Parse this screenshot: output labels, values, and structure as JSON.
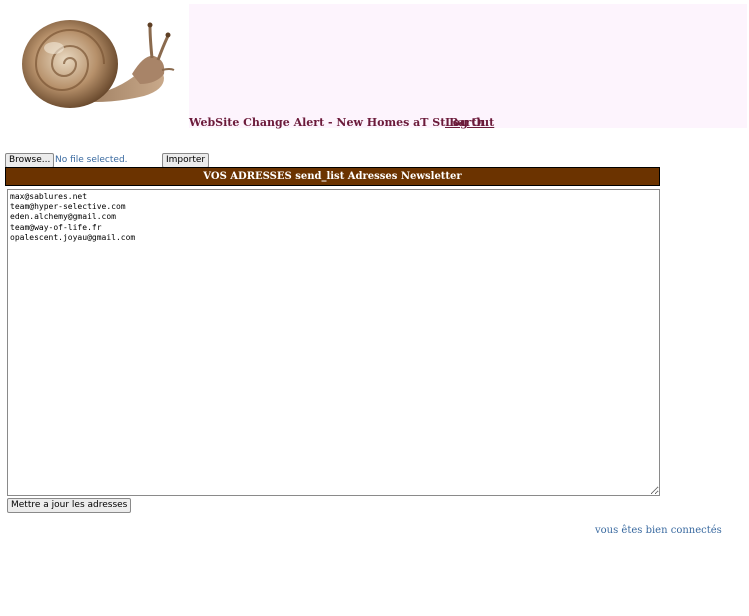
{
  "header": {
    "site_title": "WebSite Change Alert - New Homes aT St Barth",
    "logout_label": "Log Out",
    "logo_icon": "snail-logo"
  },
  "import": {
    "browse_label": "Browse...",
    "file_status": "No file selected.",
    "import_label": "Importer"
  },
  "section": {
    "title": "VOS ADRESSES send_list Adresses Newsletter"
  },
  "addresses": {
    "value": "max@sablures.net\nteam@hyper-selective.com\neden.alchemy@gmail.com\nteam@way-of-life.fr\nopalescent.joyau@gmail.com"
  },
  "actions": {
    "update_label": "Mettre a jour les adresses"
  },
  "footer": {
    "status": "vous êtes bien connectés"
  },
  "colors": {
    "header_bar": "#6b3300",
    "title_text": "#6b1a3a",
    "link_blue": "#3a6aa0",
    "panel_pink": "#fdf4fd"
  }
}
